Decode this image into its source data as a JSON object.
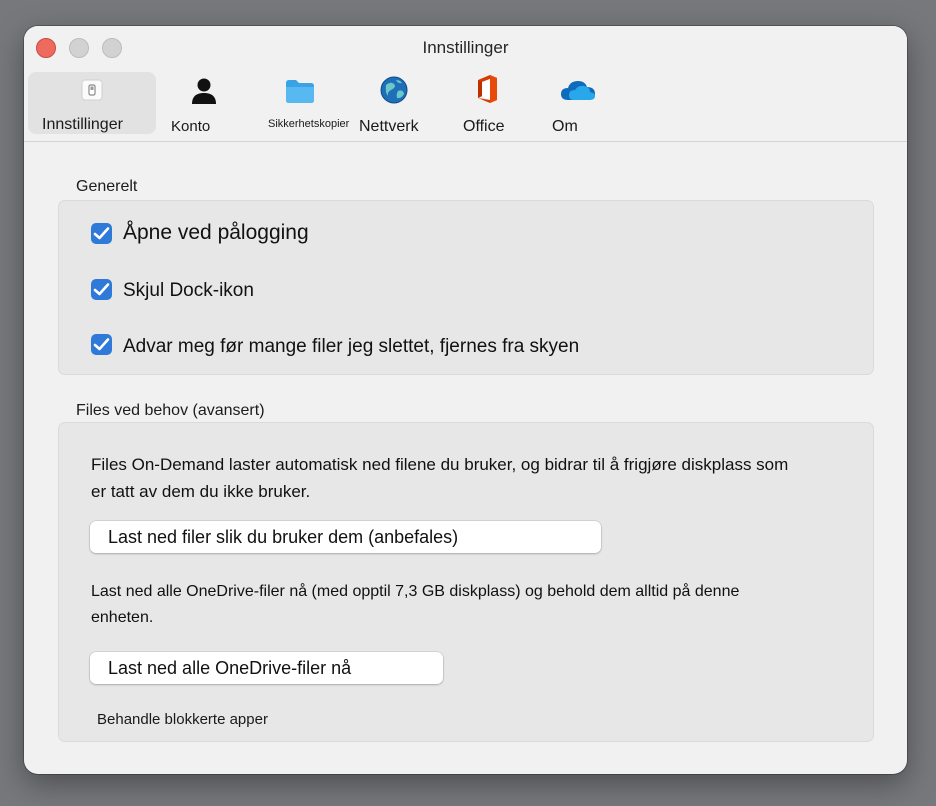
{
  "window": {
    "title": "Innstillinger"
  },
  "tabs": [
    {
      "label": "Innstillinger",
      "icon": "settings-switch-icon"
    },
    {
      "label": "Konto",
      "icon": "person-icon"
    },
    {
      "label": "Sikkerhetskopier",
      "icon": "folder-icon"
    },
    {
      "label": "Nettverk",
      "icon": "globe-network-icon"
    },
    {
      "label": "Office",
      "icon": "office-logo-icon"
    },
    {
      "label": "Om",
      "icon": "onedrive-cloud-icon"
    }
  ],
  "general": {
    "title": "Generelt",
    "options": [
      {
        "label": "Åpne ved pålogging",
        "checked": true
      },
      {
        "label": "Skjul Dock-ikon",
        "checked": true
      },
      {
        "label": "Advar meg før mange filer jeg slettet, fjernes fra skyen",
        "checked": true
      }
    ]
  },
  "files": {
    "title": "Files ved behov (avansert)",
    "description": "Files On-Demand laster automatisk ned filene du bruker, og bidrar til å frigjøre diskplass som er tatt av dem du ikke bruker.",
    "download_as_used_button": "Last ned filer slik du bruker dem (anbefales)",
    "download_all_description": "Last ned alle OneDrive-filer nå (med opptil 7,3 GB diskplass) og behold dem alltid på denne enheten.",
    "download_all_button": "Last ned alle OneDrive-filer nå",
    "blocked_apps_link": "Behandle blokkerte apper"
  },
  "colors": {
    "accent": "#2f79d9",
    "close": "#ed6a5e",
    "office": "#d83b01",
    "onedrive": "#0f6cbd"
  }
}
